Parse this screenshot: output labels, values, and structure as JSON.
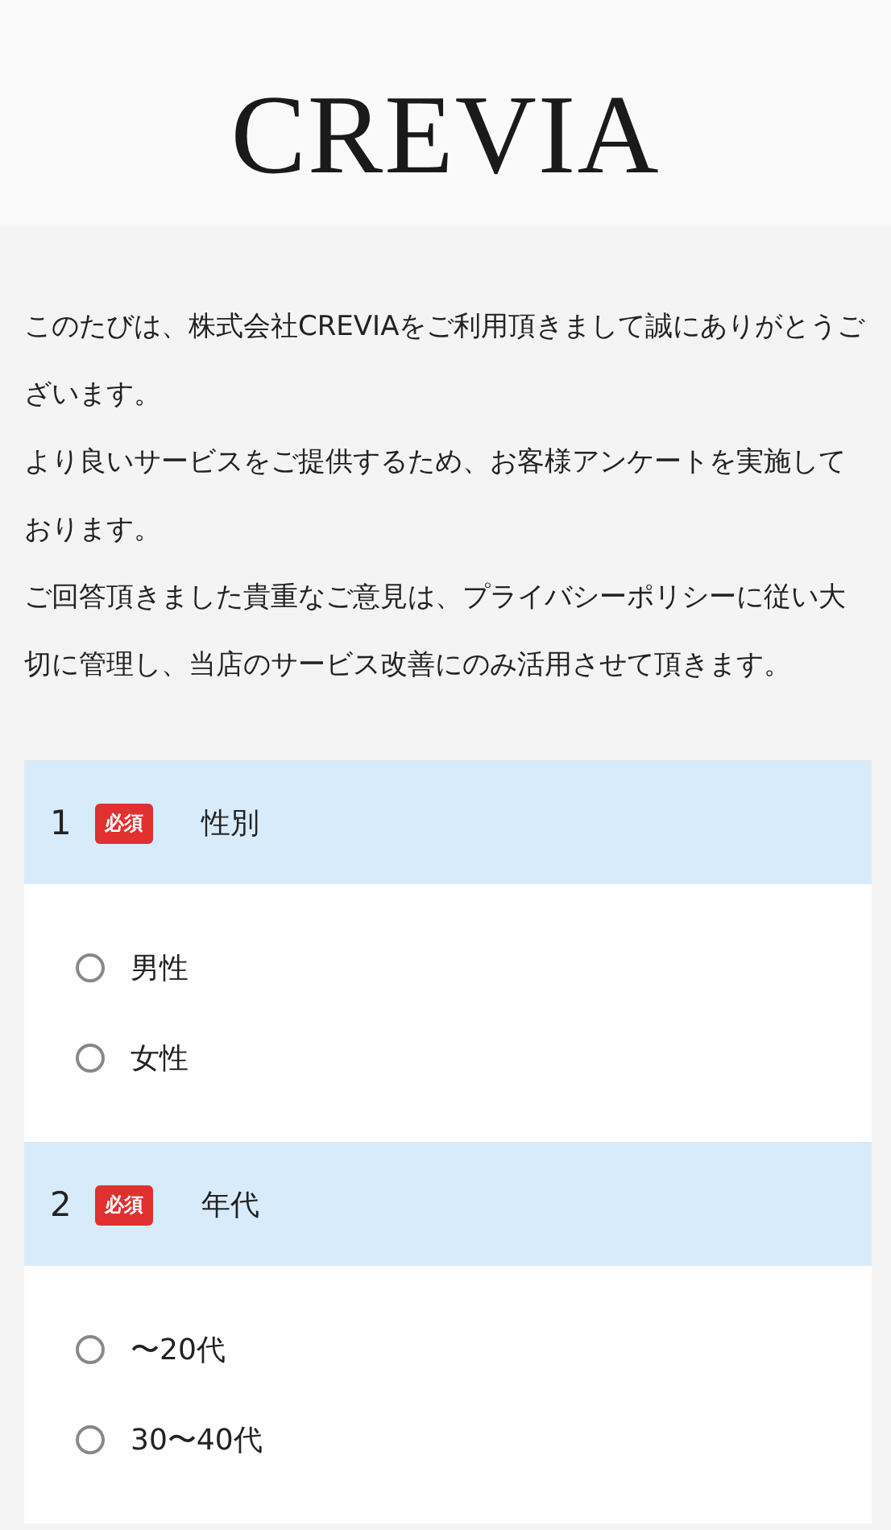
{
  "logo": "CREVIA",
  "intro": [
    "このたびは、株式会社CREVIAをご利用頂きまして誠にありがとうございます。",
    "より良いサービスをご提供するため、お客様アンケートを実施しております。",
    "ご回答頂きました貴重なご意見は、プライバシーポリシーに従い大切に管理し、当店のサービス改善にのみ活用させて頂きます。"
  ],
  "questions": [
    {
      "number": "1",
      "badge": "必須",
      "title": "性別",
      "options": [
        {
          "label": "男性",
          "selected": false
        },
        {
          "label": "女性",
          "selected": false
        }
      ]
    },
    {
      "number": "2",
      "badge": "必須",
      "title": "年代",
      "options": [
        {
          "label": "〜20代",
          "selected": false
        },
        {
          "label": "30〜40代",
          "selected": false
        }
      ]
    }
  ]
}
